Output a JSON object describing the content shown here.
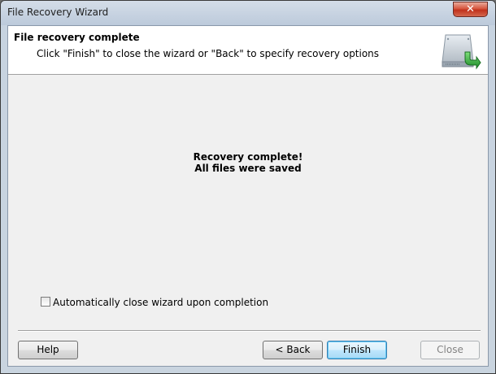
{
  "window": {
    "title": "File Recovery Wizard",
    "close_glyph": "✕"
  },
  "header": {
    "title": "File recovery complete",
    "description": "Click \"Finish\" to close the wizard or \"Back\" to specify recovery options",
    "icon": "hard-drive-recovery-icon"
  },
  "message": {
    "line1": "Recovery complete!",
    "line2": "All files were saved"
  },
  "options": {
    "auto_close_label": "Automatically close wizard upon completion",
    "auto_close_checked": false
  },
  "buttons": {
    "help": "Help",
    "back": "< Back",
    "finish": "Finish",
    "close": "Close"
  },
  "colors": {
    "accent_green": "#2fa83a",
    "default_button_border": "#3c7fb1",
    "disabled_text": "#838383"
  }
}
